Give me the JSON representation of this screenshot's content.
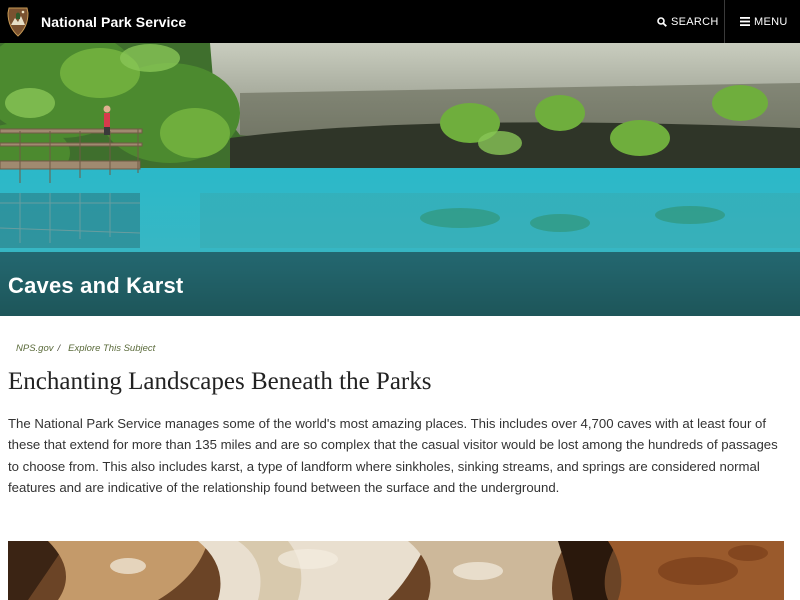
{
  "header": {
    "brand": "National Park Service",
    "search_label": "SEARCH",
    "menu_label": "MENU"
  },
  "hero": {
    "title": "Caves and Karst"
  },
  "breadcrumb": {
    "items": [
      "NPS.gov",
      "Explore This Subject"
    ],
    "separator": "/"
  },
  "main": {
    "heading": "Enchanting Landscapes Beneath the Parks",
    "intro": "The National Park Service manages some of the world's most amazing places. This includes over 4,700 caves with at least four of these that extend for more than 135 miles and are so complex that the casual visitor would be lost among the hundreds of passages to choose from. This also includes karst, a type of landform where sinkholes, sinking streams, and springs are considered normal features and are indicative of the relationship found between the surface and the underground."
  },
  "icons": {
    "logo": "nps-arrowhead-logo",
    "search": "search-icon",
    "menu": "hamburger-menu-icon"
  },
  "colors": {
    "header_bg": "#000000",
    "water": "#2fb6c8",
    "breadcrumb_link": "#5a6a3a",
    "text": "#333333"
  }
}
